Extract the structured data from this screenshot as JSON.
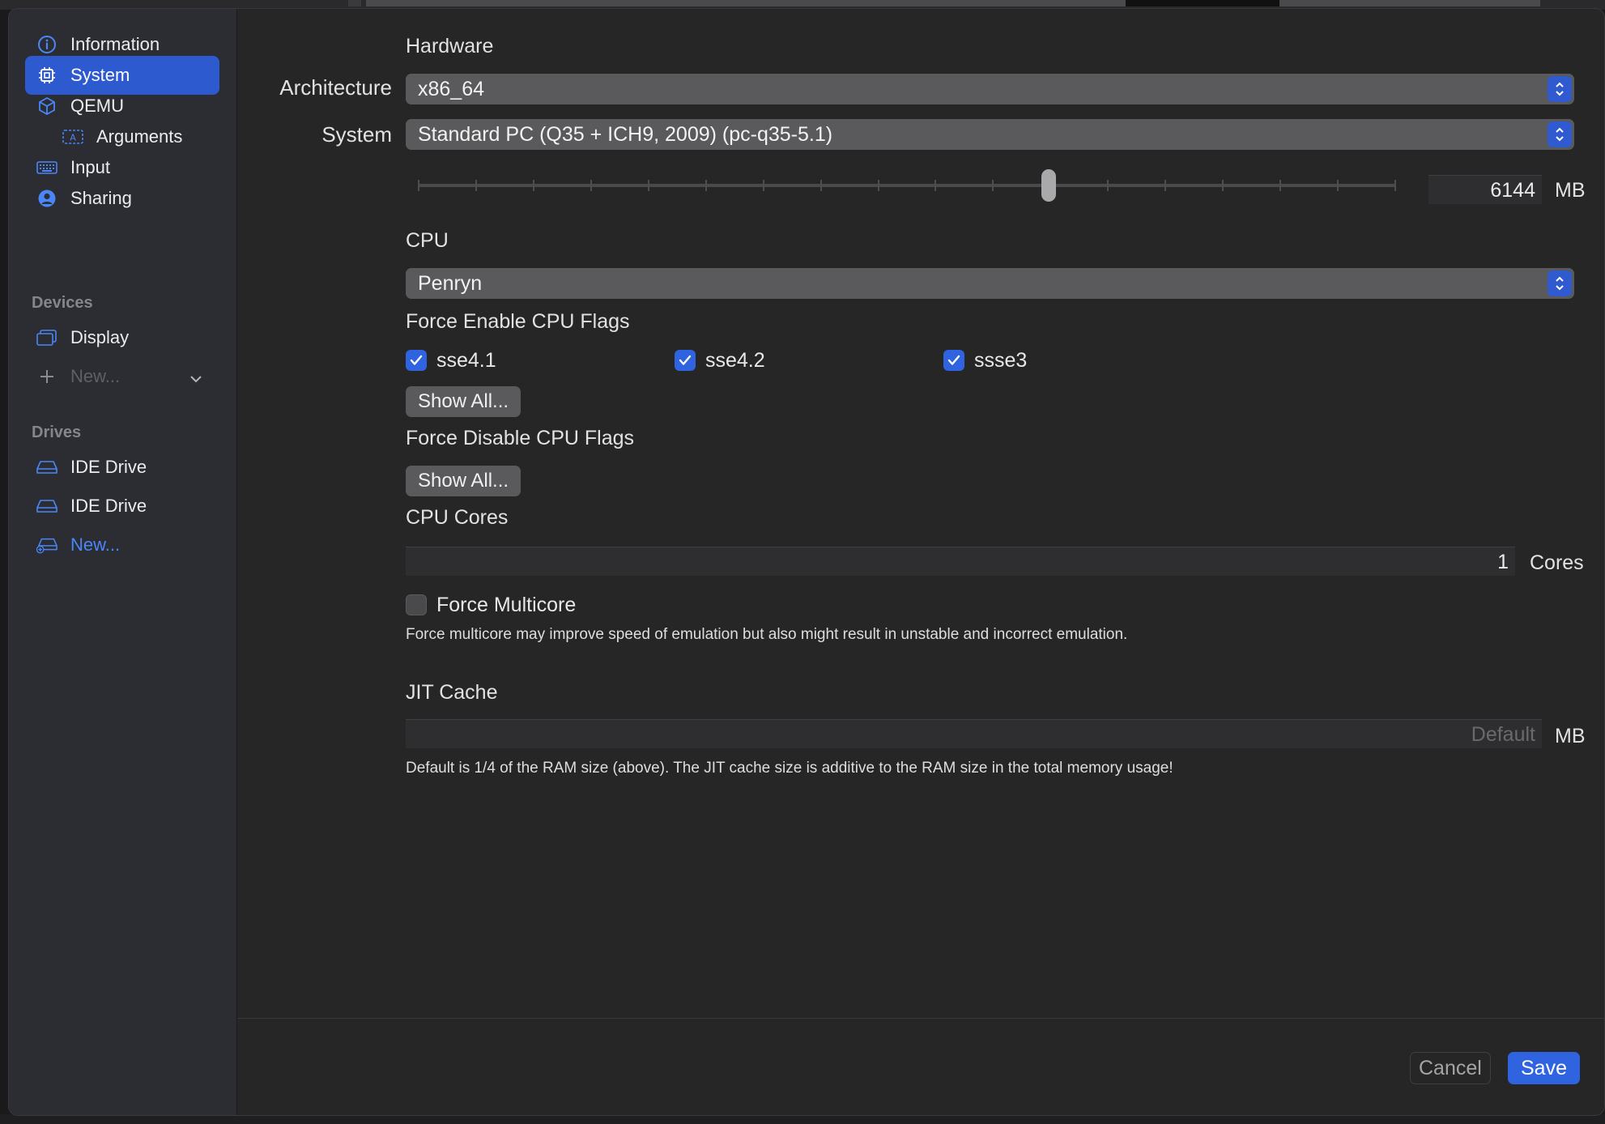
{
  "sidebar": {
    "items": [
      {
        "label": "Information",
        "icon": "info-icon"
      },
      {
        "label": "System",
        "icon": "cpu-icon",
        "selected": true
      },
      {
        "label": "QEMU",
        "icon": "cube-icon"
      },
      {
        "label": "Arguments",
        "icon": "text-field-icon"
      },
      {
        "label": "Input",
        "icon": "keyboard-icon"
      },
      {
        "label": "Sharing",
        "icon": "person-icon"
      }
    ],
    "devices_header": "Devices",
    "devices": [
      {
        "label": "Display",
        "icon": "display-icon"
      }
    ],
    "new_device_label": "New...",
    "drives_header": "Drives",
    "drives": [
      {
        "label": "IDE Drive",
        "icon": "drive-icon"
      },
      {
        "label": "IDE Drive",
        "icon": "drive-icon"
      }
    ],
    "new_drive_label": "New..."
  },
  "hardware": {
    "title": "Hardware",
    "architecture_label": "Architecture",
    "architecture_value": "x86_64",
    "system_label": "System",
    "system_value": "Standard PC (Q35 + ICH9, 2009) (pc-q35-5.1)",
    "memory_value": "6144",
    "memory_unit": "MB",
    "memory_slider_fraction": 0.645
  },
  "cpu": {
    "title": "CPU",
    "model_value": "Penryn",
    "force_enable_title": "Force Enable CPU Flags",
    "flags": [
      {
        "label": "sse4.1",
        "checked": true
      },
      {
        "label": "sse4.2",
        "checked": true
      },
      {
        "label": "ssse3",
        "checked": true
      }
    ],
    "show_all_label": "Show All...",
    "force_disable_title": "Force Disable CPU Flags",
    "show_all_disable_label": "Show All...",
    "cores_title": "CPU Cores",
    "cores_value": "1",
    "cores_unit": "Cores",
    "force_multicore_label": "Force Multicore",
    "force_multicore_help": "Force multicore may improve speed of emulation but also might result in unstable and incorrect emulation."
  },
  "jit": {
    "title": "JIT Cache",
    "placeholder": "Default",
    "unit": "MB",
    "help": "Default is 1/4 of the RAM size (above). The JIT cache size is additive to the RAM size in the total memory usage!"
  },
  "footer": {
    "cancel_label": "Cancel",
    "save_label": "Save"
  },
  "colors": {
    "accent": "#2f63e0",
    "selection": "#2e5ad0",
    "link": "#4a86f7"
  }
}
